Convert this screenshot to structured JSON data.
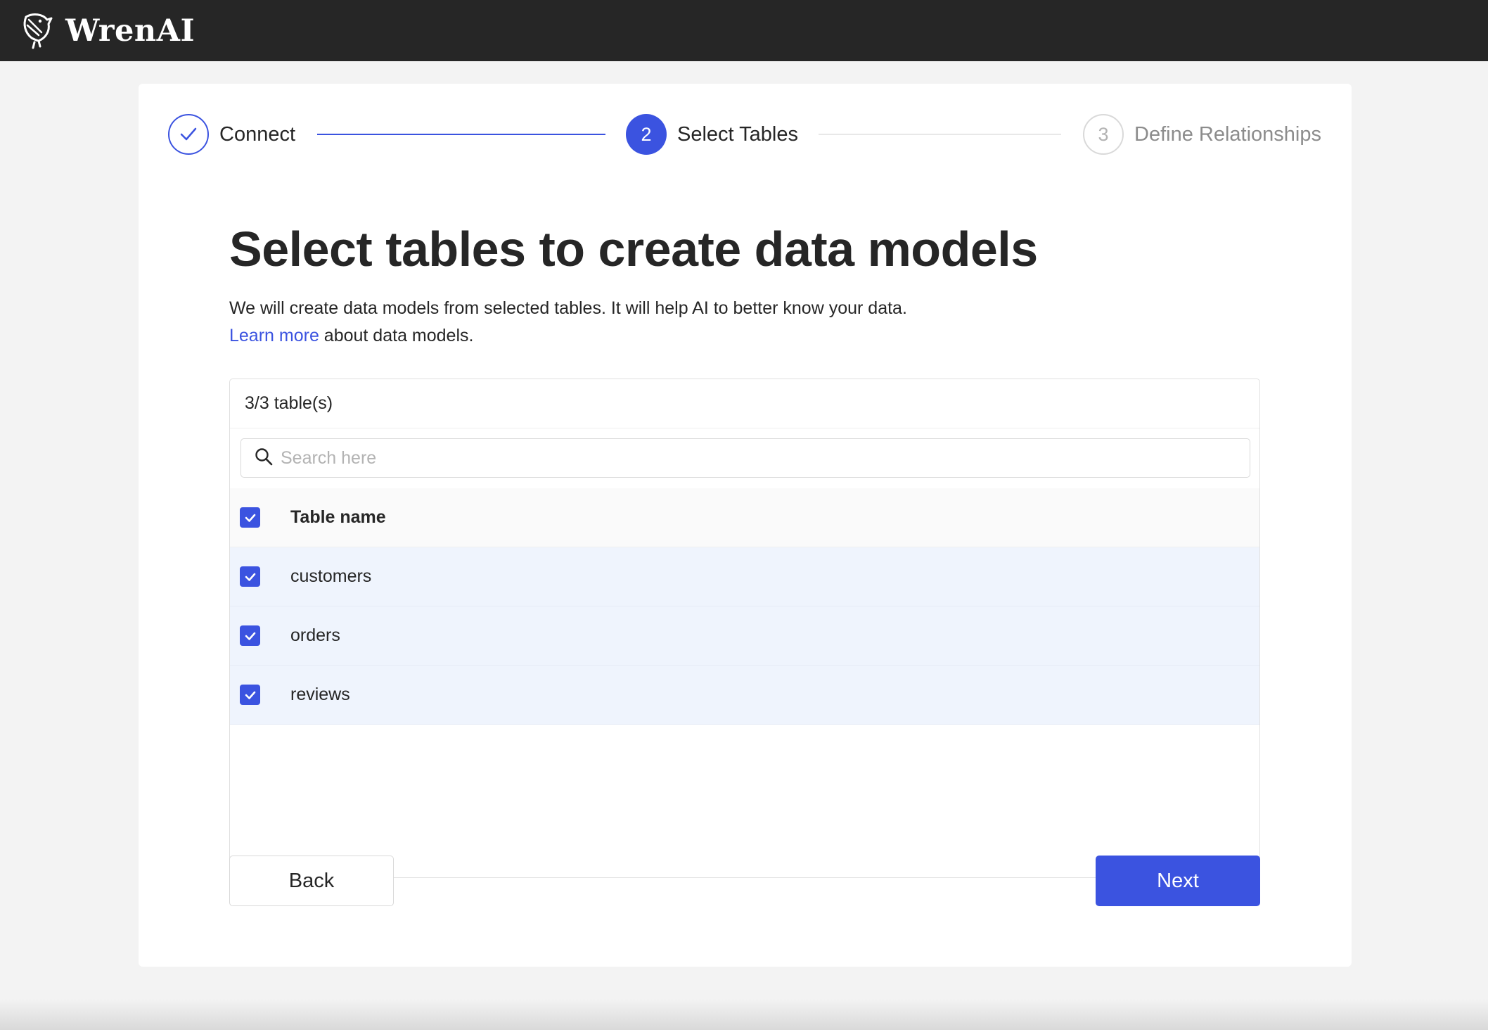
{
  "app": {
    "name": "WrenAI"
  },
  "steps": [
    {
      "label": "Connect",
      "state": "done",
      "number": ""
    },
    {
      "label": "Select Tables",
      "state": "active",
      "number": "2"
    },
    {
      "label": "Define Relationships",
      "state": "todo",
      "number": "3"
    }
  ],
  "page": {
    "title": "Select tables to create data models",
    "description": "We will create data models from selected tables. It will help AI to better know your data.",
    "learn_more_link": "Learn more",
    "learn_more_suffix": " about data models."
  },
  "table": {
    "count_label": "3/3 table(s)",
    "search_placeholder": "Search here",
    "search_value": "",
    "column_header": "Table name",
    "rows": [
      {
        "name": "customers",
        "checked": true
      },
      {
        "name": "orders",
        "checked": true
      },
      {
        "name": "reviews",
        "checked": true
      }
    ]
  },
  "buttons": {
    "back": "Back",
    "next": "Next"
  },
  "colors": {
    "primary": "#3b53e0",
    "topbar": "#262626",
    "row_selected": "#eff4fd"
  }
}
